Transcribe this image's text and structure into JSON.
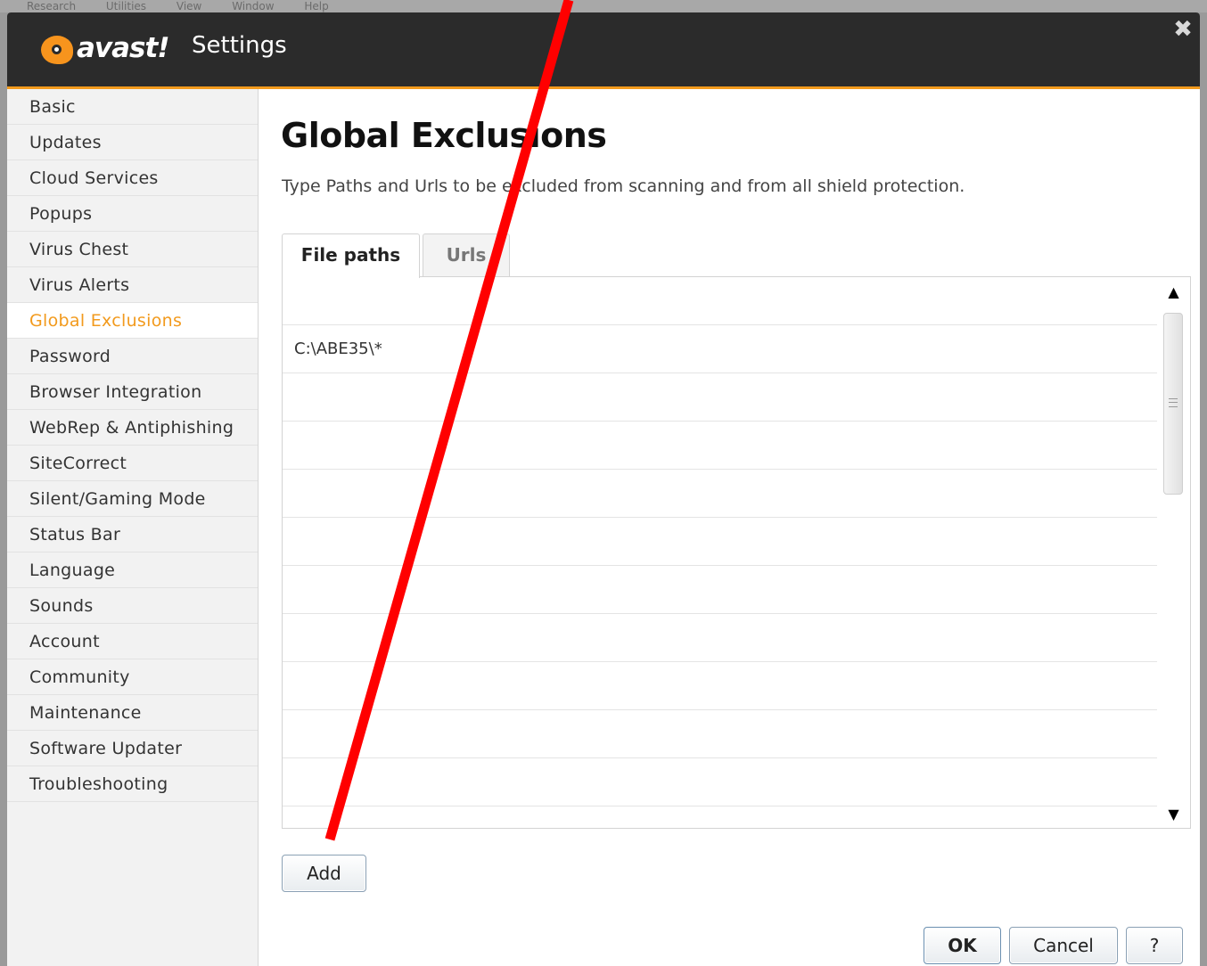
{
  "background_menu": [
    "Research",
    "Utilities",
    "View",
    "Window",
    "Help"
  ],
  "window": {
    "logo_text": "avast!",
    "title": "Settings",
    "close_symbol": "✖"
  },
  "sidebar": {
    "items": [
      {
        "label": "Basic"
      },
      {
        "label": "Updates"
      },
      {
        "label": "Cloud Services"
      },
      {
        "label": "Popups"
      },
      {
        "label": "Virus Chest"
      },
      {
        "label": "Virus Alerts"
      },
      {
        "label": "Global Exclusions",
        "active": true
      },
      {
        "label": "Password"
      },
      {
        "label": "Browser Integration"
      },
      {
        "label": "WebRep & Antiphishing"
      },
      {
        "label": "SiteCorrect"
      },
      {
        "label": "Silent/Gaming Mode"
      },
      {
        "label": "Status Bar"
      },
      {
        "label": "Language"
      },
      {
        "label": "Sounds"
      },
      {
        "label": "Account"
      },
      {
        "label": "Community"
      },
      {
        "label": "Maintenance"
      },
      {
        "label": "Software Updater"
      },
      {
        "label": "Troubleshooting"
      }
    ]
  },
  "main": {
    "title": "Global Exclusions",
    "description": "Type Paths and Urls to be excluded from scanning and from all shield protection.",
    "tabs": [
      {
        "label": "File paths",
        "selected": true
      },
      {
        "label": "Urls",
        "selected": false
      }
    ],
    "list_rows": [
      "",
      "C:\\ABE35\\*",
      "",
      "",
      "",
      "",
      "",
      "",
      "",
      "",
      "",
      ""
    ],
    "scroll_up_icon": "▲",
    "scroll_down_icon": "▼"
  },
  "buttons": {
    "add": "Add",
    "ok": "OK",
    "cancel": "Cancel",
    "help": "?"
  },
  "colors": {
    "accent": "#f29a1d",
    "titlebar": "#2b2b2b",
    "annotation_arrow": "#ff0000"
  }
}
